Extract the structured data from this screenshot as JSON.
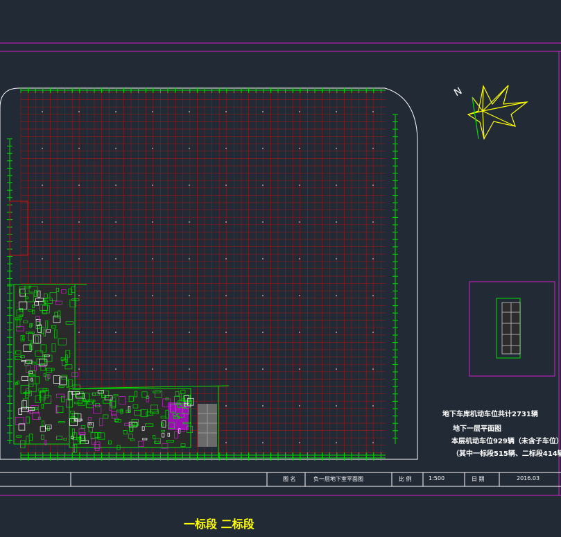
{
  "colors": {
    "background": "#222a35",
    "grid_red": "#8b1a1a",
    "green": "#00e000",
    "magenta": "#d020d0",
    "yellow": "#ffff00",
    "white": "#ffffff",
    "gray": "#7a7a7a"
  },
  "notes": {
    "total_parking": "地下车库机动车位共计2731辆",
    "floor_plan_title": "地下一层平面图",
    "floor_parking": "本层机动车位929辆（未含子车位）",
    "floor_parking_breakdown": "（其中一标段515辆、二标段414辆）"
  },
  "title_block": {
    "label_drawing_name": "图  名",
    "drawing_name": "负一层地下室平面图",
    "label_scale": "比  例",
    "scale": "1:500",
    "label_date": "日  期",
    "date": "2016.03"
  },
  "caption": "一标段 二标段",
  "compass": {
    "north_label": "N",
    "icon": "north-arrow-wind-rose-icon"
  }
}
